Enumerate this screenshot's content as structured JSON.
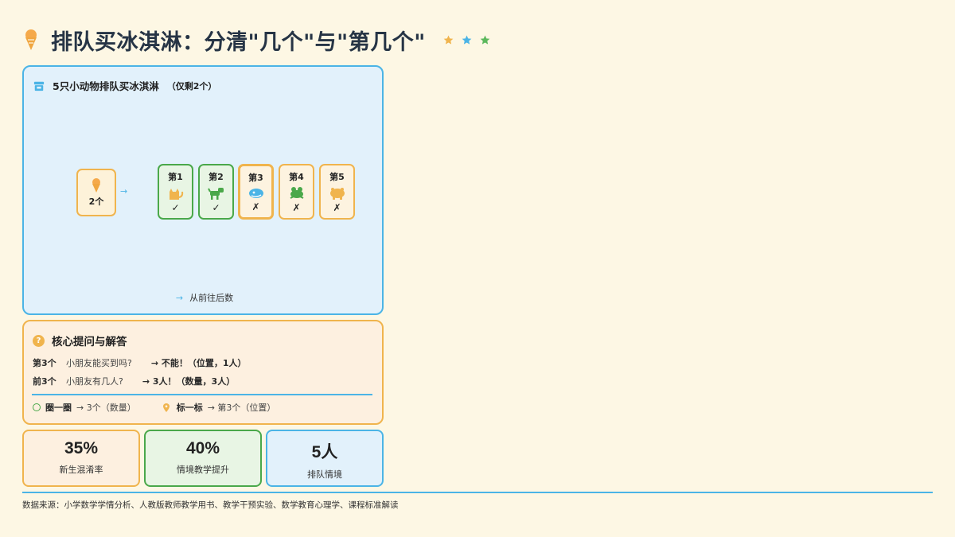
{
  "header": {
    "title": "排队买冰淇淋：分清\"几个\"与\"第几个\"",
    "icon": "ice-cream-icon",
    "stars": [
      {
        "icon": "star-icon",
        "color": "#f0b44d"
      },
      {
        "icon": "star-icon",
        "color": "#4bb4e6"
      },
      {
        "icon": "star-icon",
        "color": "#5cb85c"
      }
    ]
  },
  "queue_card": {
    "icon": "store-icon",
    "title": "5只小动物排队买冰淇淋",
    "subtitle": "（仅剩2个）",
    "stock": {
      "icon": "ice-cream-icon",
      "label": "2个"
    },
    "arrow": "→",
    "animals": [
      {
        "label": "第1",
        "icon": "cat-icon",
        "mark": "✓",
        "status": "ok"
      },
      {
        "label": "第2",
        "icon": "dog-icon",
        "mark": "✓",
        "status": "ok"
      },
      {
        "label": "第3",
        "icon": "otter-icon",
        "mark": "✗",
        "status": "no",
        "highlight": true
      },
      {
        "label": "第4",
        "icon": "frog-icon",
        "mark": "✗",
        "status": "no"
      },
      {
        "label": "第5",
        "icon": "hippo-icon",
        "mark": "✗",
        "status": "no"
      }
    ],
    "direction": {
      "arrow": "→",
      "text": "从前往后数"
    }
  },
  "qa_card": {
    "icon": "question-icon",
    "title": "核心提问与解答",
    "rows": [
      {
        "key": "第3个",
        "question": "小朋友能买到吗?",
        "answer": "→ 不能！（位置，1人）"
      },
      {
        "key": "前3个",
        "question": "小朋友有几人?",
        "answer": "→ 3人！（数量，3人）"
      }
    ],
    "tips": [
      {
        "icon": "circle-icon",
        "bold": "圈一圈",
        "text": "→ 3个（数量）"
      },
      {
        "icon": "pin-icon",
        "bold": "标一标",
        "text": "→ 第3个（位置）"
      }
    ]
  },
  "stats": [
    {
      "value": "35%",
      "label": "新生混淆率",
      "color": "#f0b44d"
    },
    {
      "value": "40%",
      "label": "情境教学提升",
      "color": "#4aa84a"
    },
    {
      "value": "5人",
      "label": "排队情境",
      "color": "#4bb4e6"
    }
  ],
  "footer": {
    "source": "数据来源：小学数学学情分析、人教版教师教学用书、教学干预实验、数学教育心理学、课程标准解读"
  }
}
